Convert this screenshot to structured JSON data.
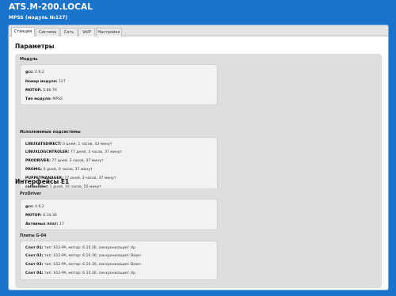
{
  "header": {
    "title": "ATS.M-200.LOCAL",
    "subtitle": "MPSS (модуль №127)"
  },
  "tabs": [
    {
      "label": "Станция",
      "active": true
    },
    {
      "label": "Система",
      "active": false
    },
    {
      "label": "Сеть",
      "active": false
    },
    {
      "label": "VoIP",
      "active": false
    },
    {
      "label": "Настройки",
      "active": false
    }
  ],
  "params": {
    "title": "Параметры",
    "module": {
      "label": "Модуль",
      "rows": [
        {
          "key": "gcc:",
          "value": "4.9.2"
        },
        {
          "key": "Номер модуля:",
          "value": "127"
        },
        {
          "key": "MOTOP:",
          "value": "5.86.76"
        },
        {
          "key": "Тип модуля:",
          "value": "MPSS"
        }
      ]
    },
    "subsystems": {
      "label": "Исполняемые подсистемы",
      "rows": [
        {
          "key": "LINUXATSDIRECT:",
          "value": "0 дней, 1 часов, 43 минут"
        },
        {
          "key": "LINUXLOGCNTROLER:",
          "value": "77 дней, 3 часов, 37 минут"
        },
        {
          "key": "PRODRIVER:",
          "value": "77 дней, 3 часов, 37 минут"
        },
        {
          "key": "PROMG:",
          "value": "0 дней, 0 часов, 37 минут"
        },
        {
          "key": "PUPPETMANAGER:",
          "value": "77 дней, 3 часов, 37 минут"
        },
        {
          "key": "callbuilder:",
          "value": "1 дней, 16 часов, 50 минут"
        }
      ]
    }
  },
  "interfaces": {
    "title": "Интерфейсы E1",
    "prodriver": {
      "label": "ProDriver",
      "rows": [
        {
          "key": "gcc:",
          "value": "4.9.2"
        },
        {
          "key": "MOTOP:",
          "value": "6.10.36"
        },
        {
          "key": "Активных плат:",
          "value": "17"
        }
      ]
    },
    "boards": {
      "label": "Платы G-04",
      "rows": [
        {
          "key": "Слот 01:",
          "value": "тип: S12-PA, мотор: 6.10.30, синхронизация: Up"
        },
        {
          "key": "Слот 02:",
          "value": "тип: S12-PA, мотор: 6.10.30, синхронизация: Down"
        },
        {
          "key": "Слот 03:",
          "value": "тип: S12-PA, мотор: 6.10.30, синхронизация: Down"
        },
        {
          "key": "Слот 04:",
          "value": "тип: S12-PA, мотор: 6.10.30, синхронизация: Up"
        }
      ]
    }
  }
}
